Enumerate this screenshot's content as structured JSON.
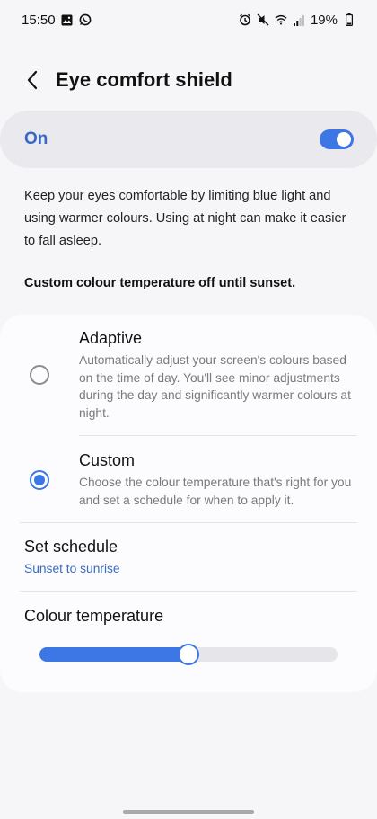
{
  "status_bar": {
    "time": "15:50",
    "left_icons": [
      "gallery-icon",
      "whatsapp-icon"
    ],
    "right_icons": [
      "alarm-icon",
      "mute-icon",
      "wifi-icon",
      "signal-icon"
    ],
    "battery": "19%"
  },
  "header": {
    "title": "Eye comfort shield",
    "back_icon": "back-arrow-icon"
  },
  "toggle": {
    "label": "On",
    "state": true,
    "accent_color": "#3d77e6"
  },
  "description": "Keep your eyes comfortable by limiting blue light and using warmer colours. Using at night can make it easier to fall asleep.",
  "status_note": "Custom colour temperature off until sunset.",
  "options": [
    {
      "title": "Adaptive",
      "description": "Automatically adjust your screen's colours based on the time of day. You'll see minor adjustments during the day and significantly warmer colours at night.",
      "selected": false
    },
    {
      "title": "Custom",
      "description": "Choose the colour temperature that's right for you and set a schedule for when to apply it.",
      "selected": true
    }
  ],
  "schedule": {
    "title": "Set schedule",
    "value": "Sunset to sunrise"
  },
  "colour_temperature": {
    "title": "Colour temperature",
    "level": 0.5
  }
}
